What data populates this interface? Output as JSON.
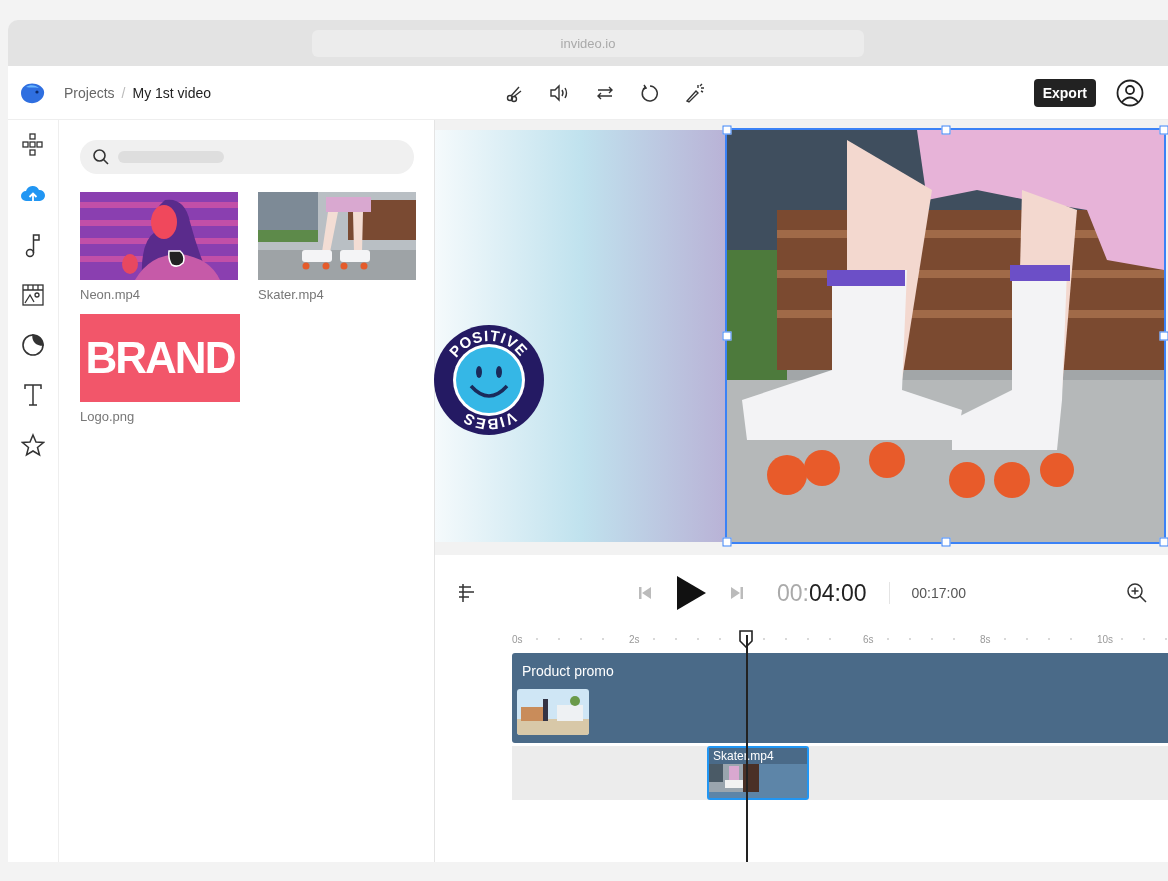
{
  "browser": {
    "url": "invideo.io"
  },
  "header": {
    "breadcrumb": [
      {
        "label": "Projects",
        "current": false
      },
      {
        "label": "My 1st video",
        "current": true
      }
    ],
    "separator": "/",
    "export_label": "Export"
  },
  "sidebar": {
    "items": [
      {
        "kind": "templates",
        "selected": false
      },
      {
        "kind": "upload",
        "selected": true
      },
      {
        "kind": "music",
        "selected": false
      },
      {
        "kind": "media",
        "selected": false
      },
      {
        "kind": "stickers",
        "selected": false
      },
      {
        "kind": "text",
        "selected": false
      },
      {
        "kind": "favorites",
        "selected": false
      }
    ]
  },
  "assets": {
    "items": [
      {
        "kind": "video",
        "name": "Neon.mp4",
        "hovered": true
      },
      {
        "kind": "video",
        "name": "Skater.mp4",
        "hovered": false
      },
      {
        "kind": "logo",
        "name": "Logo.png",
        "logo_text": "BRAND",
        "hovered": false
      }
    ]
  },
  "preview": {
    "sticker": {
      "top_text": "POSITIVE",
      "bottom_text": "VIBES"
    },
    "photo_selected": true
  },
  "timeline": {
    "time_dim": "00:",
    "time": "04:00",
    "duration": "00:17:00",
    "ruler": [
      {
        "kind": "tick",
        "label": "0s"
      },
      {
        "kind": "tick",
        "label": "2s"
      },
      {
        "kind": "playhead"
      },
      {
        "kind": "tick",
        "label": "6s"
      },
      {
        "kind": "tick",
        "label": "8s"
      },
      {
        "kind": "tick",
        "label": "10s"
      }
    ],
    "tracks": [
      {
        "title": "Product promo",
        "selected": false
      },
      {
        "title": "Skater.mp4",
        "selected": true
      }
    ]
  }
}
